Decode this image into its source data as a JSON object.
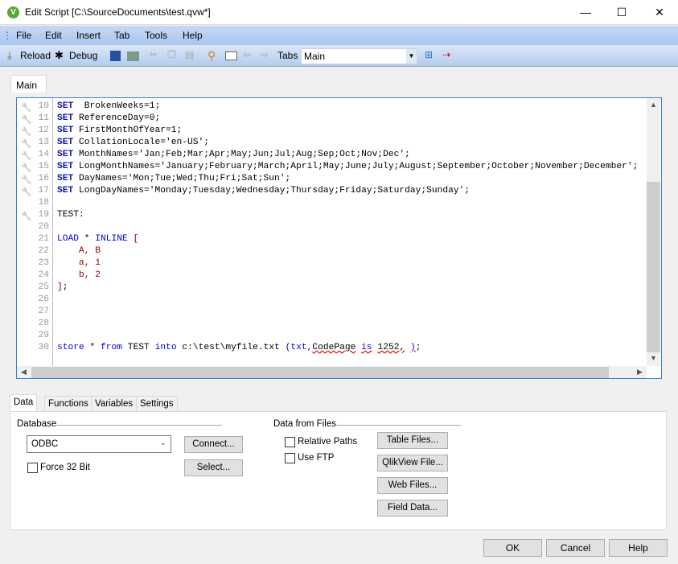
{
  "window": {
    "title": "Edit Script [C:\\SourceDocuments\\test.qvw*]",
    "app_icon": "V",
    "minimize": "—",
    "maximize": "☐",
    "close": "✕"
  },
  "menu": [
    "File",
    "Edit",
    "Insert",
    "Tab",
    "Tools",
    "Help"
  ],
  "toolbar": {
    "reload": "Reload",
    "debug": "Debug",
    "tabs_label": "Tabs",
    "tabs_value": "Main"
  },
  "editor_tab": "Main",
  "editor": {
    "lines": [
      {
        "n": "10",
        "w": true,
        "t": [
          [
            "kwb",
            "SET"
          ],
          [
            "",
            "  BrokenWeeks=1;"
          ]
        ]
      },
      {
        "n": "11",
        "w": true,
        "t": [
          [
            "kwb",
            "SET"
          ],
          [
            "",
            " ReferenceDay=0;"
          ]
        ]
      },
      {
        "n": "12",
        "w": true,
        "t": [
          [
            "kwb",
            "SET"
          ],
          [
            "",
            " FirstMonthOfYear=1;"
          ]
        ]
      },
      {
        "n": "13",
        "w": true,
        "t": [
          [
            "kwb",
            "SET"
          ],
          [
            "",
            " CollationLocale='en-US';"
          ]
        ]
      },
      {
        "n": "14",
        "w": true,
        "t": [
          [
            "kwb",
            "SET"
          ],
          [
            "",
            " MonthNames='Jan;Feb;Mar;Apr;May;Jun;Jul;Aug;Sep;Oct;Nov;Dec';"
          ]
        ]
      },
      {
        "n": "15",
        "w": true,
        "t": [
          [
            "kwb",
            "SET"
          ],
          [
            "",
            " LongMonthNames='January;February;March;April;May;June;July;August;September;October;November;December';"
          ]
        ]
      },
      {
        "n": "16",
        "w": true,
        "t": [
          [
            "kwb",
            "SET"
          ],
          [
            "",
            " DayNames='Mon;Tue;Wed;Thu;Fri;Sat;Sun';"
          ]
        ]
      },
      {
        "n": "17",
        "w": true,
        "t": [
          [
            "kwb",
            "SET"
          ],
          [
            "",
            " LongDayNames='Monday;Tuesday;Wednesday;Thursday;Friday;Saturday;Sunday';"
          ]
        ]
      },
      {
        "n": "18",
        "w": false,
        "t": []
      },
      {
        "n": "19",
        "w": true,
        "t": [
          [
            "",
            "TEST:"
          ]
        ]
      },
      {
        "n": "20",
        "w": false,
        "t": []
      },
      {
        "n": "21",
        "w": false,
        "t": [
          [
            "kw",
            "LOAD"
          ],
          [
            "",
            " * "
          ],
          [
            "kw",
            "INLINE"
          ],
          [
            "dat",
            " ["
          ]
        ]
      },
      {
        "n": "22",
        "w": false,
        "t": [
          [
            "dat",
            "    A, B"
          ]
        ]
      },
      {
        "n": "23",
        "w": false,
        "t": [
          [
            "dat",
            "    a, 1"
          ]
        ]
      },
      {
        "n": "24",
        "w": false,
        "t": [
          [
            "dat",
            "    b, 2"
          ]
        ]
      },
      {
        "n": "25",
        "w": false,
        "t": [
          [
            "dat",
            "]"
          ],
          [
            "",
            ";"
          ]
        ]
      },
      {
        "n": "26",
        "w": false,
        "t": []
      },
      {
        "n": "27",
        "w": false,
        "t": []
      },
      {
        "n": "28",
        "w": false,
        "t": []
      },
      {
        "n": "29",
        "w": false,
        "t": []
      },
      {
        "n": "30",
        "w": false,
        "t": [
          [
            "kw",
            "store"
          ],
          [
            "",
            " * "
          ],
          [
            "kw",
            "from"
          ],
          [
            "",
            " TEST "
          ],
          [
            "kw",
            "into"
          ],
          [
            "",
            " c:\\test\\myfile.txt "
          ],
          [
            "kw",
            "(txt,"
          ],
          [
            "sq",
            "CodePage"
          ],
          [
            "",
            " "
          ],
          [
            "sq kw",
            "is"
          ],
          [
            "",
            " "
          ],
          [
            "sq",
            "1252,"
          ],
          [
            "",
            " "
          ],
          [
            "sq kw",
            ")"
          ],
          [
            "",
            ";"
          ]
        ]
      }
    ]
  },
  "bottom_tabs": [
    "Data",
    "Functions",
    "Variables",
    "Settings"
  ],
  "data_panel": {
    "database_label": "Database",
    "database_value": "ODBC",
    "connect": "Connect...",
    "select": "Select...",
    "force32": "Force 32 Bit",
    "files_label": "Data from Files",
    "relative_paths": "Relative Paths",
    "use_ftp": "Use FTP",
    "table_files": "Table Files...",
    "qlikview_file": "QlikView File...",
    "web_files": "Web Files...",
    "field_data": "Field Data..."
  },
  "dialog": {
    "ok": "OK",
    "cancel": "Cancel",
    "help": "Help"
  }
}
